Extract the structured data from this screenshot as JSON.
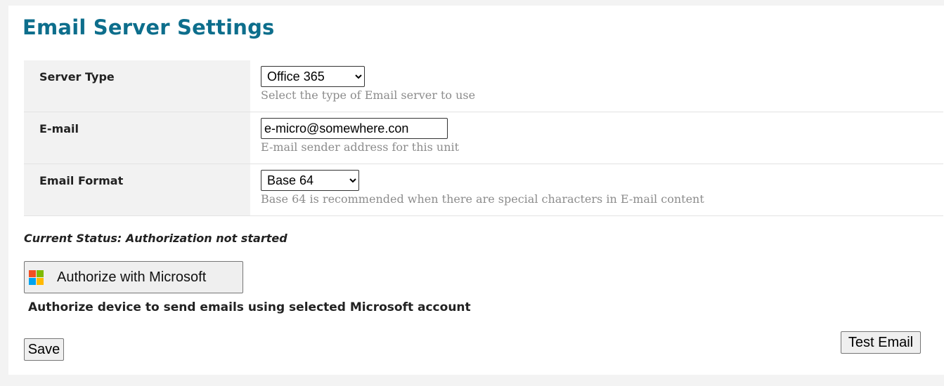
{
  "page": {
    "title": "Email Server Settings"
  },
  "settings": {
    "server_type": {
      "label": "Server Type",
      "selected": "Office 365",
      "hint": "Select the type of Email server to use"
    },
    "email": {
      "label": "E-mail",
      "value": "e-micro@somewhere.con",
      "hint": "E-mail sender address for this unit"
    },
    "email_format": {
      "label": "Email Format",
      "selected": "Base 64",
      "hint": "Base 64 is recommended when there are special characters in E-mail content"
    }
  },
  "status": {
    "text": "Current Status: Authorization not started"
  },
  "authorize": {
    "button_label": "Authorize with Microsoft",
    "description": "Authorize device to send emails using selected Microsoft account",
    "logo_icon": "microsoft-logo-icon",
    "logo_colors": [
      "#f25022",
      "#7fba00",
      "#00a4ef",
      "#ffb900"
    ]
  },
  "actions": {
    "save_label": "Save",
    "test_label": "Test Email"
  },
  "colors": {
    "title": "#0d6e8c",
    "hint": "#8c8c8c",
    "label_bg": "#f2f2f2"
  }
}
